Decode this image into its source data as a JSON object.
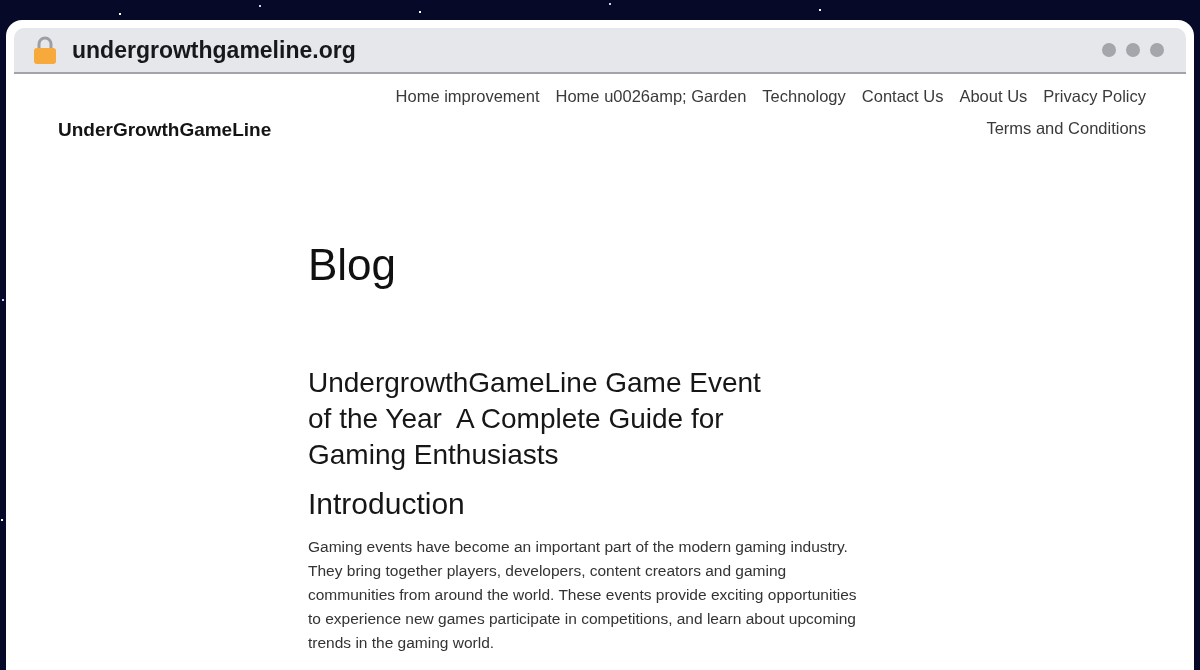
{
  "browser": {
    "url": "undergrowthgameline.org"
  },
  "site": {
    "title": "UnderGrowthGameLine",
    "nav": [
      {
        "label": "Home improvement"
      },
      {
        "label": "Home u0026amp; Garden"
      },
      {
        "label": "Technology"
      },
      {
        "label": "Contact Us"
      },
      {
        "label": "About Us"
      },
      {
        "label": "Privacy Policy"
      },
      {
        "label": "Terms and Conditions"
      }
    ]
  },
  "page": {
    "heading": "Blog",
    "article": {
      "title": "UndergrowthGameLine Game Event of the Year  A Complete Guide for Gaming Enthusiasts",
      "sections": [
        {
          "heading": "Introduction",
          "paragraph": "Gaming events have become an important part of the modern gaming industry. They bring together players, developers, content creators and gaming communities from around the world. These events provide exciting opportunities to experience new games participate in competitions, and learn about upcoming trends in the gaming world."
        }
      ]
    }
  }
}
